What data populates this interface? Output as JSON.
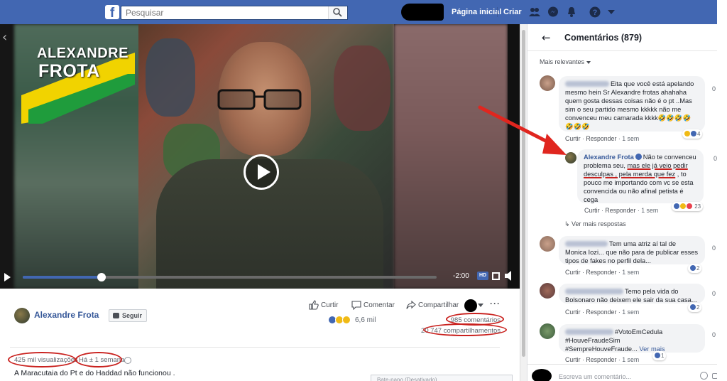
{
  "topbar": {
    "logo_letter": "f",
    "search_placeholder": "Pesquisar",
    "home_link": "Página inicial",
    "create_link": "Criar",
    "colors": {
      "bar": "#4267b2"
    },
    "icons": [
      "friends-icon",
      "messenger-icon",
      "notifications-icon",
      "help-icon",
      "account-menu-caret-icon"
    ]
  },
  "video": {
    "brand_line1": "ALEXANDRE",
    "brand_line2": "FROTA",
    "time_remaining": "-2:00",
    "hd_badge": "HD",
    "progress": 0.19
  },
  "post": {
    "page_name": "Alexandre Frota",
    "follow_label": "Seguir",
    "actions": {
      "like": "Curtir",
      "comment": "Comentar",
      "share": "Compartilhar"
    },
    "reactions_count": "6,6 mil",
    "comments_count": "985 comentários",
    "shares_count": "20.747 compartilhamentos",
    "views": "425 mil visualizações",
    "age": "Há ± 1 semana",
    "description": "A Maracutaia do Pt e do Haddad não funcionou .",
    "bottom_box_label": "Bate-papo (Desativado)"
  },
  "comments_panel": {
    "title": "Comentários (879)",
    "sort_label": "Mais relevantes",
    "more_replies": "Ver mais respostas",
    "composer_placeholder": "Escreva um comentário...",
    "action_like": "Curtir",
    "action_reply": "Responder",
    "time": "1 sem",
    "comments": [
      {
        "text_lines": [
          "Eita que você está apelando",
          "mesmo hein Sr Alexandre frotas ahahaha",
          "quem gosta dessas coisas não é o pt ..Mas",
          "sim o seu partido mesmo kkkkk não me",
          "convenceu meu camarada kkkk🤣🤣🤣🤣",
          "🤣🤣🤣"
        ],
        "reactions": "4",
        "side_count": "0"
      },
      {
        "author": "Alexandre Frota",
        "text_1": "Não te convenceu",
        "text_2": "problema seu, ",
        "text_underlined_1": "mas ele já veio pedir",
        "text_underlined_2": "desculpas , pela merda que fez",
        "text_3": " , to",
        "text_4": "pouco me importando com vc se esta",
        "text_5": "convencida ou não afinal petista é",
        "text_6": "cega",
        "reactions": "23",
        "side_count": "0"
      },
      {
        "text_lines": [
          "Tem uma atriz aí tal de",
          "Monica Iozi... que não para de publicar esses",
          "tipos de fakes no perfil dela..."
        ],
        "reactions": "2",
        "side_count": "0"
      },
      {
        "text_lines": [
          "Temo pela vida do",
          "Bolsonaro não deixem ele sair da sua casa..."
        ],
        "reactions": "2",
        "side_count": "0"
      },
      {
        "text_lines": [
          "#VotoEmCedula",
          "#HouveFraudeSim",
          "#SempreHouveFraude..."
        ],
        "see_more": "Ver mais",
        "reactions": "1",
        "side_count": "0"
      }
    ]
  }
}
